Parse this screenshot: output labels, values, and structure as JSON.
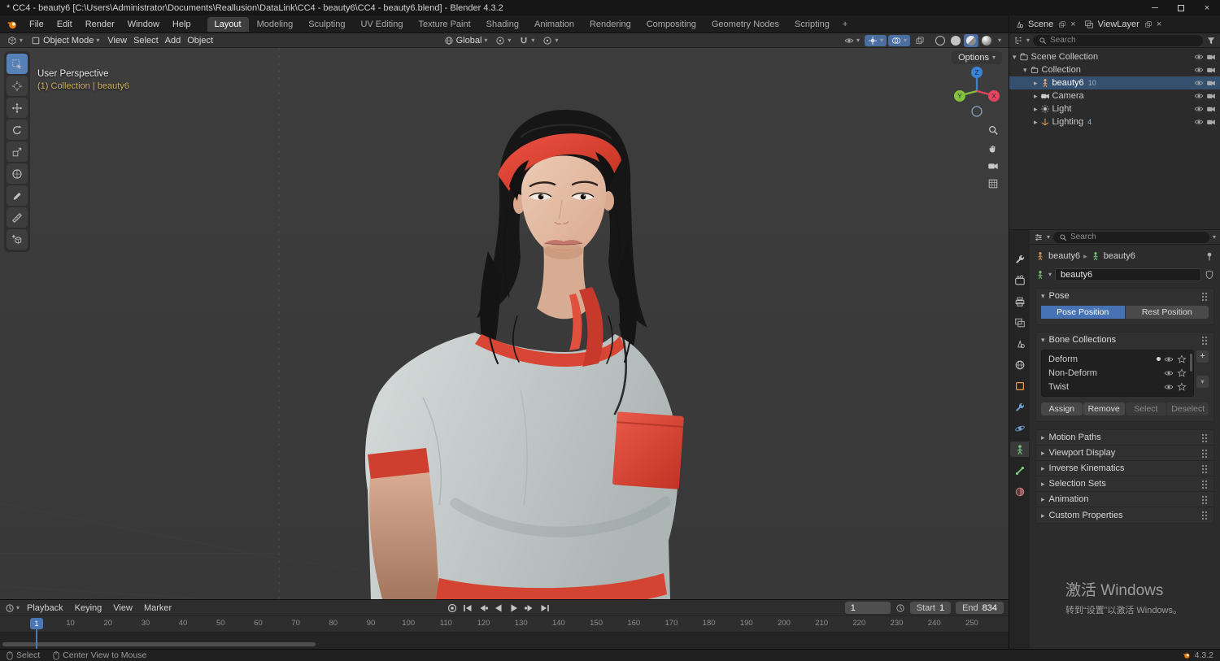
{
  "titlebar": {
    "title": "* CC4 - beauty6 [C:\\Users\\Administrator\\Documents\\Reallusion\\DataLink\\CC4 - beauty6\\CC4 - beauty6.blend] - Blender 4.3.2"
  },
  "menubar": {
    "menus": [
      "File",
      "Edit",
      "Render",
      "Window",
      "Help"
    ],
    "workspaces": [
      {
        "label": "Layout",
        "active": true
      },
      {
        "label": "Modeling"
      },
      {
        "label": "Sculpting"
      },
      {
        "label": "UV Editing"
      },
      {
        "label": "Texture Paint"
      },
      {
        "label": "Shading"
      },
      {
        "label": "Animation"
      },
      {
        "label": "Rendering"
      },
      {
        "label": "Compositing"
      },
      {
        "label": "Geometry Nodes"
      },
      {
        "label": "Scripting"
      }
    ],
    "add_workspace": "+",
    "scene_label": "Scene",
    "viewlayer_label": "ViewLayer"
  },
  "viewport_header": {
    "mode": "Object Mode",
    "menus": [
      "View",
      "Select",
      "Add",
      "Object"
    ],
    "orientation": "Global",
    "options_label": "Options"
  },
  "toolbar": {
    "tools": [
      {
        "name": "tool-select-box",
        "icon": "t-select",
        "active": true
      },
      {
        "name": "tool-3d-cursor",
        "icon": "t-cursor"
      },
      {
        "name": "tool-move",
        "icon": "t-move"
      },
      {
        "name": "tool-rotate",
        "icon": "t-rotate"
      },
      {
        "name": "tool-scale",
        "icon": "t-scale"
      },
      {
        "name": "tool-transform",
        "icon": "t-transform"
      },
      {
        "name": "tool-annotate",
        "icon": "t-annotate"
      },
      {
        "name": "tool-measure",
        "icon": "t-measure"
      },
      {
        "name": "tool-add-cube",
        "icon": "t-addcube"
      }
    ]
  },
  "viewport": {
    "perspective_label": "User Perspective",
    "collection_label": "(1) Collection | beauty6",
    "gizmo_axes": [
      "Z",
      "Y",
      "X"
    ]
  },
  "outliner": {
    "search_placeholder": "Search",
    "rows": [
      {
        "label": "Scene Collection",
        "indent": 0,
        "icon": "i-scenecoll",
        "open": true,
        "tint": "#d5d5d5"
      },
      {
        "label": "Collection",
        "indent": 1,
        "icon": "i-collection",
        "open": true,
        "tint": "#d5d5d5"
      },
      {
        "label": "beauty6",
        "indent": 2,
        "icon": "i-armature",
        "selected": true,
        "badge": "10",
        "tint": "#eca96a"
      },
      {
        "label": "Camera",
        "indent": 2,
        "icon": "i-cam",
        "tint": "#c9c9c9"
      },
      {
        "label": "Light",
        "indent": 2,
        "icon": "i-light",
        "tint": "#c9c9c9"
      },
      {
        "label": "Lighting",
        "indent": 2,
        "icon": "i-empty",
        "badge": "4",
        "tint": "#eca96a"
      }
    ]
  },
  "properties": {
    "search_placeholder": "Search",
    "breadcrumb": {
      "object": "beauty6",
      "data": "beauty6"
    },
    "name_value": "beauty6",
    "pose_label": "Pose",
    "pose_buttons": [
      {
        "label": "Pose Position",
        "active": true
      },
      {
        "label": "Rest Position"
      }
    ],
    "bone_collections_label": "Bone Collections",
    "bone_collections": [
      {
        "label": "Deform",
        "dot": true
      },
      {
        "label": "Non-Deform"
      },
      {
        "label": "Twist"
      }
    ],
    "action_buttons": [
      {
        "label": "Assign"
      },
      {
        "label": "Remove"
      },
      {
        "label": "Select",
        "disabled": true
      },
      {
        "label": "Deselect",
        "disabled": true
      }
    ],
    "collapsed_sections": [
      "Motion Paths",
      "Viewport Display",
      "Inverse Kinematics",
      "Selection Sets",
      "Animation",
      "Custom Properties"
    ],
    "tabs": [
      {
        "name": "tool-tab",
        "icon": "i-wrench"
      },
      {
        "name": "render-tab",
        "icon": "i-camback"
      },
      {
        "name": "output-tab",
        "icon": "i-printer"
      },
      {
        "name": "view-layer-tab",
        "icon": "i-images"
      },
      {
        "name": "scene-tab",
        "icon": "i-scenecone"
      },
      {
        "name": "world-tab",
        "icon": "i-globe"
      },
      {
        "name": "object-tab",
        "icon": "i-square",
        "tint": "#e8984d"
      },
      {
        "name": "modifiers-tab",
        "icon": "i-wrench",
        "tint": "#6f9fd3"
      },
      {
        "name": "physics-tab",
        "icon": "i-orbit",
        "tint": "#6f9fd3"
      },
      {
        "name": "object-data-tab",
        "icon": "i-armature",
        "tint": "#79c879",
        "active": true
      },
      {
        "name": "bone-tab",
        "icon": "i-bone",
        "tint": "#79c879"
      },
      {
        "name": "material-tab",
        "icon": "i-sphere",
        "tint": "#cf7f7f"
      }
    ]
  },
  "timeline": {
    "menus": [
      {
        "label": "Playback",
        "caret": true
      },
      {
        "label": "Keying",
        "caret": true
      },
      {
        "label": "View"
      },
      {
        "label": "Marker"
      }
    ],
    "playback_controls": [
      {
        "name": "auto-keying-button",
        "icon": "i-rec"
      },
      {
        "name": "jump-to-start-button",
        "icon": "i-jumpstart"
      },
      {
        "name": "previous-keyframe-button",
        "icon": "i-prevkey"
      },
      {
        "name": "play-reverse-button",
        "icon": "i-playrev"
      },
      {
        "name": "play-button",
        "icon": "i-play"
      },
      {
        "name": "next-keyframe-button",
        "icon": "i-nextkey"
      },
      {
        "name": "jump-to-end-button",
        "icon": "i-jumpend"
      }
    ],
    "current_frame": "1",
    "marker_frame": "1",
    "start_label": "Start",
    "start_value": "1",
    "end_label": "End",
    "end_value": "834",
    "ticks": [
      1,
      10,
      20,
      30,
      40,
      50,
      60,
      70,
      80,
      90,
      100,
      110,
      120,
      130,
      140,
      150,
      160,
      170,
      180,
      190,
      200,
      210,
      220,
      230,
      240,
      250
    ]
  },
  "statusbar": {
    "left": "Select",
    "middle": "Center View to Mouse",
    "version": "4.3.2"
  },
  "watermark": {
    "line1": "激活 Windows",
    "line2": "转到“设置”以激活 Windows。"
  },
  "colors": {
    "accent_blue": "#4772b3",
    "selected_row": "#34506e",
    "axis_x": "#e2455c",
    "axis_y": "#85c13c",
    "axis_z": "#3a83d6",
    "object_orange": "#e8984d",
    "armature_green": "#79c879"
  }
}
